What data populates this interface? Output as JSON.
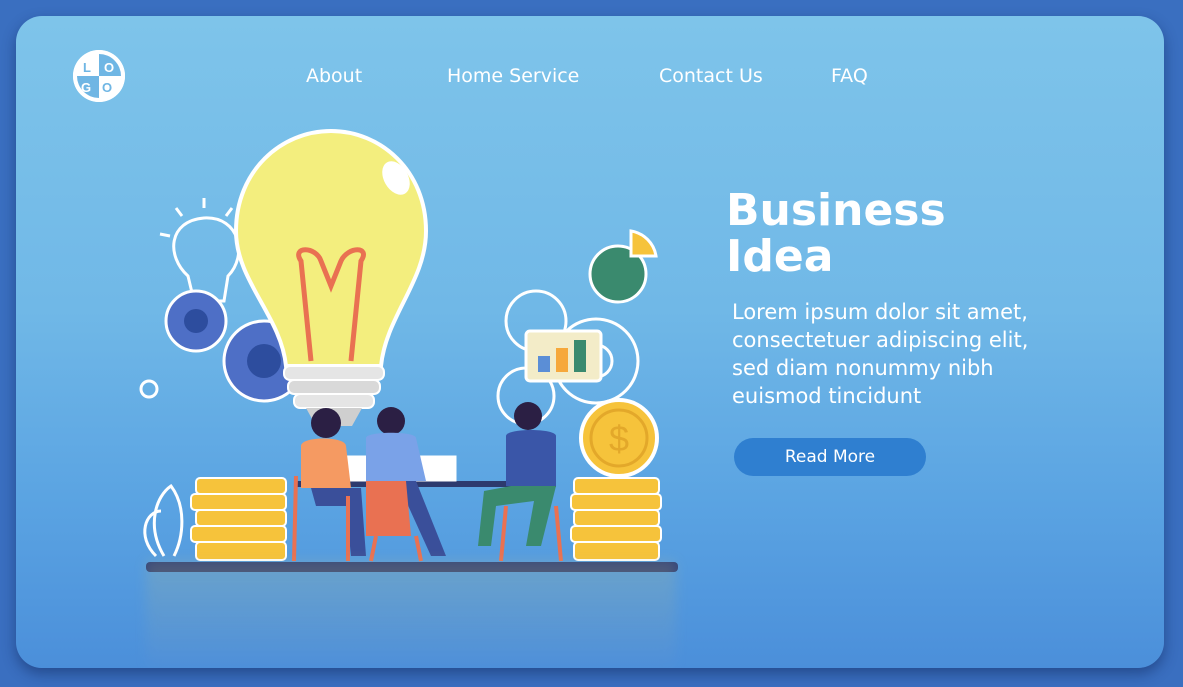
{
  "logo": {
    "text": "LOGO",
    "icon": "logo-icon"
  },
  "nav": {
    "items": [
      {
        "label": "About"
      },
      {
        "label": "Home  Service"
      },
      {
        "label": "Contact Us"
      },
      {
        "label": "FAQ"
      }
    ]
  },
  "hero": {
    "title_line1": "Business",
    "title_line2": "Idea",
    "body_line1": "Lorem ipsum dolor sit amet,",
    "body_line2": "consectetuer adipiscing elit,",
    "body_line3": "sed diam nonummy nibh",
    "body_line4": "euismod tincidunt",
    "cta_label": "Read More"
  },
  "illustration": {
    "icons": [
      "lightbulb-icon",
      "gear-icon",
      "pie-chart-icon",
      "bar-chart-icon",
      "dollar-coin-icon",
      "coin-stack-icon",
      "team-people-icon"
    ]
  },
  "colors": {
    "background": "#70b8e7",
    "cta": "#2f7fd0",
    "bulb": "#f3ee7e",
    "gear": "#4e6fc6",
    "coin": "#f6c33b"
  }
}
